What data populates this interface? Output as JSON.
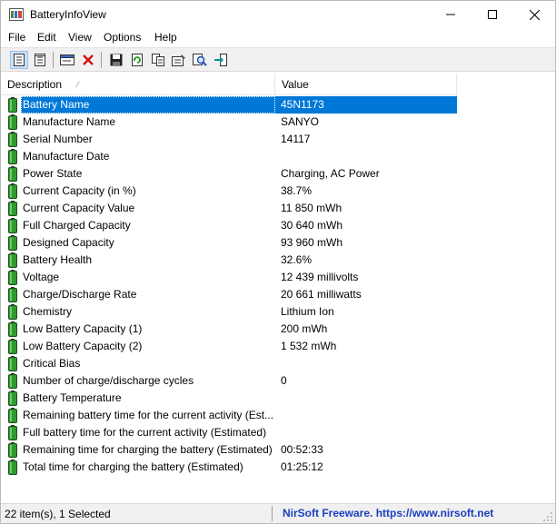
{
  "window": {
    "title": "BatteryInfoView"
  },
  "menu": [
    "File",
    "Edit",
    "View",
    "Options",
    "Help"
  ],
  "toolbar": {
    "buttons": [
      {
        "name": "html-report-all-icon"
      },
      {
        "name": "html-report-selected-icon"
      },
      {
        "name": "properties-window-icon"
      },
      {
        "name": "delete-icon"
      },
      {
        "name": "save-icon"
      },
      {
        "name": "refresh-icon"
      },
      {
        "name": "copy-icon"
      },
      {
        "name": "properties-icon"
      },
      {
        "name": "find-icon"
      },
      {
        "name": "exit-icon"
      }
    ]
  },
  "table": {
    "headers": {
      "description": "Description",
      "value": "Value"
    },
    "rows": [
      {
        "description": "Battery Name",
        "value": "45N1173"
      },
      {
        "description": "Manufacture Name",
        "value": "SANYO"
      },
      {
        "description": "Serial Number",
        "value": "14117"
      },
      {
        "description": "Manufacture Date",
        "value": ""
      },
      {
        "description": "Power State",
        "value": "Charging, AC Power"
      },
      {
        "description": "Current Capacity (in %)",
        "value": "38.7%"
      },
      {
        "description": "Current Capacity Value",
        "value": "11 850 mWh"
      },
      {
        "description": "Full Charged Capacity",
        "value": "30 640 mWh"
      },
      {
        "description": "Designed Capacity",
        "value": "93 960 mWh"
      },
      {
        "description": "Battery Health",
        "value": "32.6%"
      },
      {
        "description": "Voltage",
        "value": "12 439 millivolts"
      },
      {
        "description": "Charge/Discharge Rate",
        "value": "20 661 milliwatts"
      },
      {
        "description": "Chemistry",
        "value": "Lithium Ion"
      },
      {
        "description": "Low Battery Capacity (1)",
        "value": "200 mWh"
      },
      {
        "description": "Low Battery Capacity (2)",
        "value": "1 532 mWh"
      },
      {
        "description": "Critical Bias",
        "value": ""
      },
      {
        "description": "Number of charge/discharge cycles",
        "value": "0"
      },
      {
        "description": "Battery Temperature",
        "value": ""
      },
      {
        "description": "Remaining battery time for the current activity (Est...",
        "value": ""
      },
      {
        "description": "Full battery time for the current activity (Estimated)",
        "value": ""
      },
      {
        "description": "Remaining time for charging the battery (Estimated)",
        "value": "00:52:33"
      },
      {
        "description": "Total  time for charging the battery (Estimated)",
        "value": "01:25:12"
      }
    ],
    "selected_index": 0
  },
  "status": {
    "left": "22 item(s), 1 Selected",
    "right": "NirSoft Freeware. https://www.nirsoft.net"
  },
  "colors": {
    "selection": "#0078d7",
    "battery_green": "#2e9b2e",
    "link_blue": "#1a3fbf"
  }
}
